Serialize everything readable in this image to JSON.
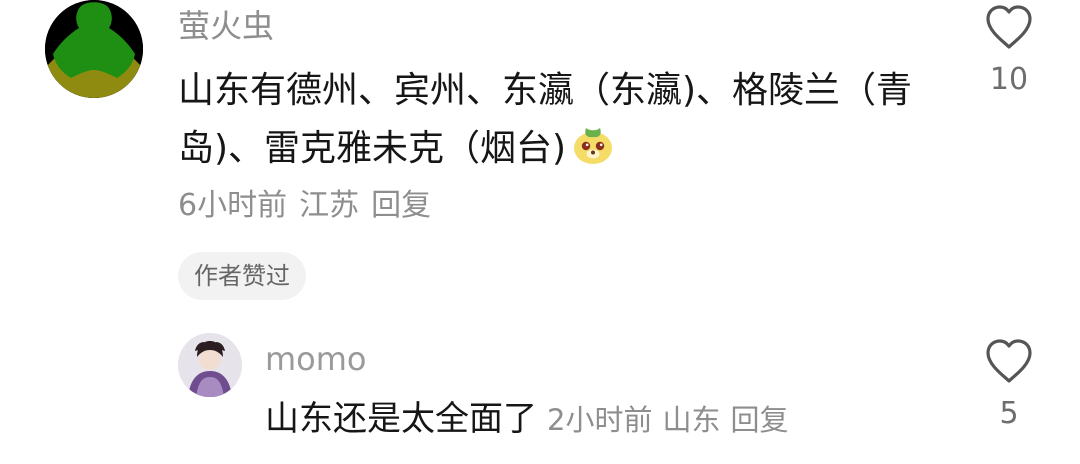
{
  "main_comment": {
    "username": "萤火虫",
    "text": "山东有德州、宾州、东瀛（东瀛)、格陵兰（青岛)、雷克雅未克（烟台)",
    "time": "6小时前",
    "location": "江苏",
    "reply_label": "回复",
    "author_liked": "作者赞过",
    "like_count": "10",
    "emoji": "dog-face-emoji"
  },
  "reply_comment": {
    "username": "momo",
    "text": "山东还是太全面了",
    "time": "2小时前",
    "location": "山东",
    "reply_label": "回复",
    "like_count": "5"
  },
  "icons": {
    "like": "heart-outline-icon"
  },
  "colors": {
    "avatar_green": "#1f8f14",
    "avatar_olive": "#8f8a10",
    "meta_gray": "#8e8e8e"
  }
}
